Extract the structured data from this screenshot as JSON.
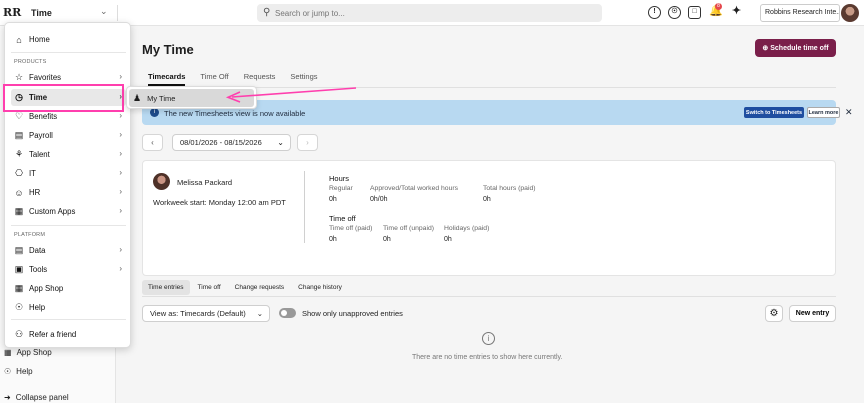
{
  "topbar": {
    "logo": "RR",
    "app_title": "Time",
    "search_placeholder": "Search or jump to...",
    "notification_count": "8",
    "company_name": "Robbins Research Inte..."
  },
  "bg_sidebar": {
    "app_shop": "App Shop",
    "help": "Help",
    "collapse": "Collapse panel"
  },
  "menu": {
    "home": "Home",
    "products_heading": "PRODUCTS",
    "favorites": "Favorites",
    "time": "Time",
    "benefits": "Benefits",
    "payroll": "Payroll",
    "talent": "Talent",
    "it": "IT",
    "hr": "HR",
    "custom_apps": "Custom Apps",
    "platform_heading": "PLATFORM",
    "data": "Data",
    "tools": "Tools",
    "app_shop": "App Shop",
    "help": "Help",
    "refer": "Refer a friend"
  },
  "submenu": {
    "my_time": "My Time"
  },
  "page": {
    "title": "My Time",
    "schedule_button": "Schedule time off",
    "tabs": [
      "Timecards",
      "Time Off",
      "Requests",
      "Settings"
    ]
  },
  "banner": {
    "message": "The new Timesheets view is now available",
    "switch_button": "Switch to Timesheets",
    "learn_button": "Learn more"
  },
  "date_range": "08/01/2026 - 08/15/2026",
  "employee": {
    "name": "Melissa Packard",
    "workweek": "Workweek start: Monday 12:00 am PDT"
  },
  "hours": {
    "title": "Hours",
    "regular_label": "Regular",
    "regular_value": "0h",
    "approved_label": "Approved/Total worked hours",
    "approved_value": "0h/0h",
    "total_label": "Total hours (paid)",
    "total_value": "0h"
  },
  "time_off": {
    "title": "Time off",
    "paid_label": "Time off (paid)",
    "paid_value": "0h",
    "unpaid_label": "Time off (unpaid)",
    "unpaid_value": "0h",
    "holidays_label": "Holidays (paid)",
    "holidays_value": "0h"
  },
  "subtabs": [
    "Time entries",
    "Time off",
    "Change requests",
    "Change history"
  ],
  "controls": {
    "view_select": "View as: Timecards (Default)",
    "toggle_label": "Show only unapproved entries",
    "new_entry": "New entry"
  },
  "empty_state": "There are no time entries to show here currently.",
  "colors": {
    "brand": "#7a1f4a",
    "banner": "#b8d9f1",
    "highlight": "#ff3fae"
  }
}
